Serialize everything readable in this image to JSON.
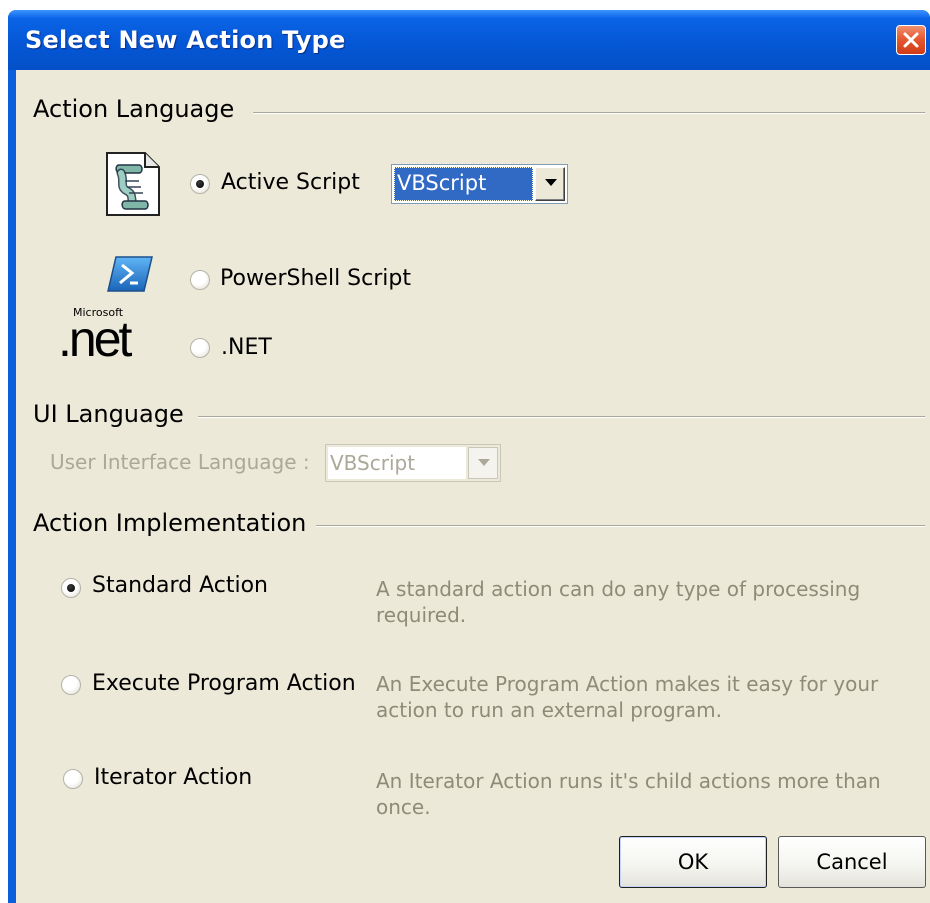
{
  "window": {
    "title": "Select New Action Type"
  },
  "action_language": {
    "heading": "Action Language",
    "options": [
      {
        "label": "Active Script",
        "selected": true,
        "icon": "script-scroll-icon"
      },
      {
        "label": "PowerShell Script",
        "selected": false,
        "icon": "powershell-icon"
      },
      {
        "label": ".NET",
        "selected": false,
        "icon": "dotnet-logo-icon"
      }
    ],
    "script_language_value": "VBScript",
    "dotnet_logo_text": "Microsoft",
    "dotnet_logo_mark": ".net"
  },
  "ui_language": {
    "heading": "UI Language",
    "label": "User Interface Language :",
    "value": "VBScript"
  },
  "action_implementation": {
    "heading": "Action Implementation",
    "options": [
      {
        "label": "Standard Action",
        "selected": true,
        "description": "A standard action can do any type of processing required."
      },
      {
        "label": "Execute Program Action",
        "selected": false,
        "description": "An Execute Program Action makes it easy for your action to run an external program."
      },
      {
        "label": "Iterator Action",
        "selected": false,
        "description": "An Iterator Action runs it's child actions more than once."
      }
    ]
  },
  "buttons": {
    "ok": "OK",
    "cancel": "Cancel"
  },
  "colors": {
    "titlebar": "#0557d6",
    "client": "#ece9d8",
    "selection": "#316ac5",
    "close": "#e65a33"
  }
}
